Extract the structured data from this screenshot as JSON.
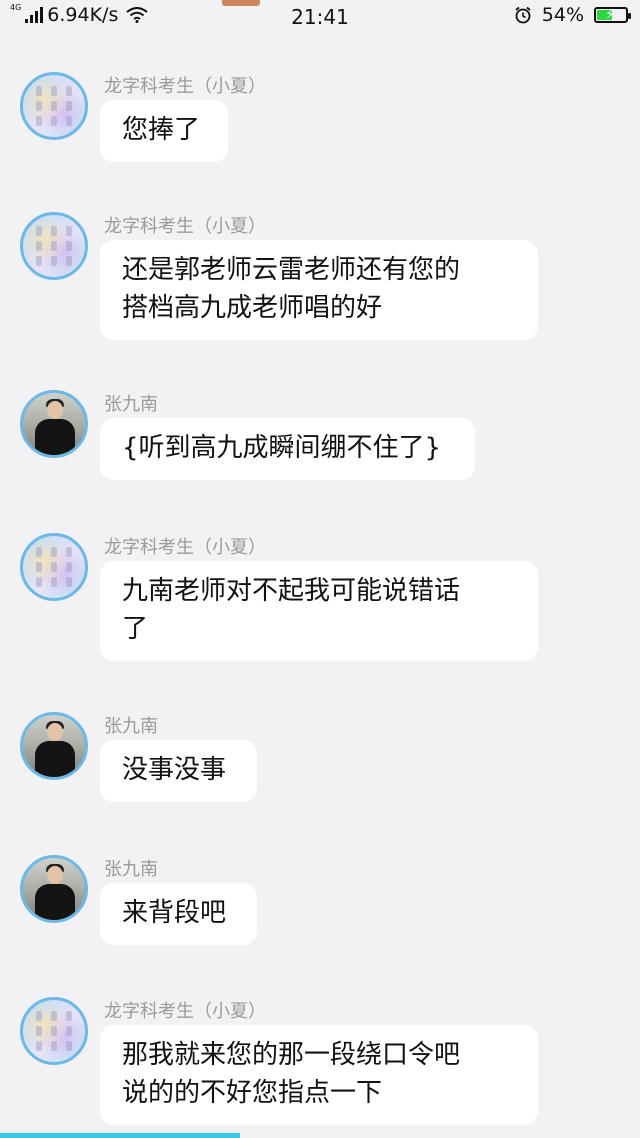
{
  "status_bar": {
    "network_type": "4G",
    "speed": "6.94K/s",
    "time": "21:41",
    "battery_percent": "54%",
    "battery_level": 0.54,
    "battery_color": "#2bd640",
    "icons": [
      "signal-icon",
      "wifi-icon",
      "alarm-icon",
      "battery-icon"
    ]
  },
  "messages": [
    {
      "sender": "龙字科考生（小夏）",
      "text": "您捧了",
      "avatar": "student-avatar"
    },
    {
      "sender": "龙字科考生（小夏）",
      "text": "还是郭老师云雷老师还有您的\n搭档高九成老师唱的好",
      "avatar": "student-avatar"
    },
    {
      "sender": "张九南",
      "text": "{听到高九成瞬间绷不住了}",
      "avatar": "teacher-avatar"
    },
    {
      "sender": "龙字科考生（小夏）",
      "text": "九南老师对不起我可能说错话\n了",
      "avatar": "student-avatar"
    },
    {
      "sender": "张九南",
      "text": "没事没事",
      "avatar": "teacher-avatar"
    },
    {
      "sender": "张九南",
      "text": "来背段吧",
      "avatar": "teacher-avatar"
    },
    {
      "sender": "龙字科考生（小夏）",
      "text": "那我就来您的那一段绕口令吧\n说的的不好您指点一下",
      "avatar": "student-avatar"
    }
  ],
  "progress": {
    "value": 0.375,
    "color": "#38c8e4"
  }
}
